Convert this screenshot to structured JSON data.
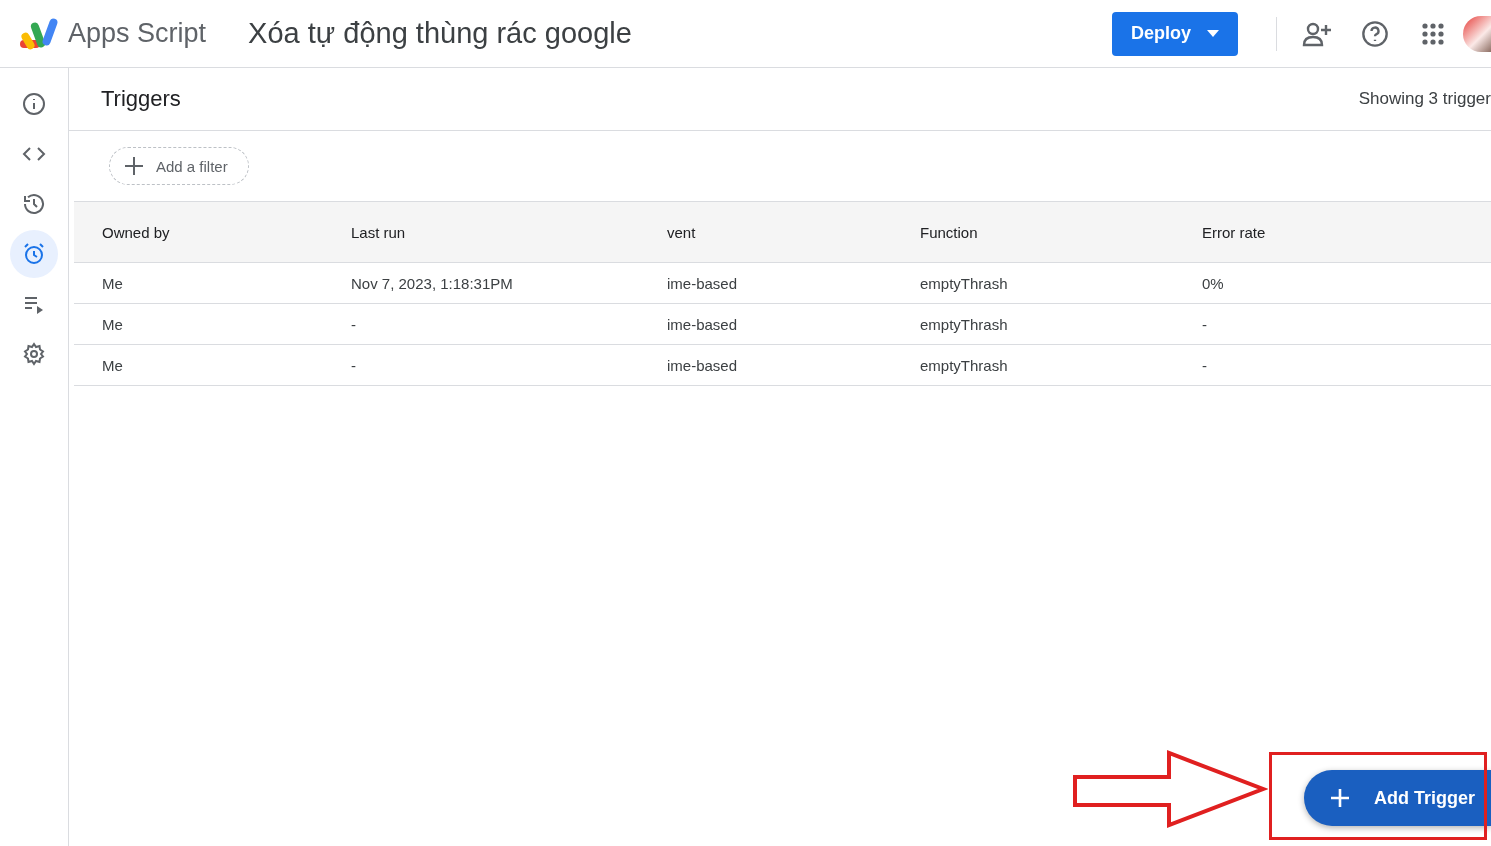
{
  "header": {
    "product": "Apps Script",
    "project_title": "Xóa tự động thùng rác google",
    "deploy_button": "Deploy"
  },
  "sidebar": {
    "items": [
      {
        "kind": "info",
        "selected": false
      },
      {
        "kind": "code",
        "selected": false
      },
      {
        "kind": "history",
        "selected": false
      },
      {
        "kind": "alarm",
        "selected": true
      },
      {
        "kind": "executions",
        "selected": false
      },
      {
        "kind": "settings",
        "selected": false
      }
    ]
  },
  "page": {
    "title": "Triggers",
    "count": "Showing 3 trigger",
    "filter_button": "Add a filter"
  },
  "table": {
    "columns": [
      "Owned by",
      "Last run",
      "vent",
      "Function",
      "Error rate"
    ],
    "rows": [
      [
        "Me",
        "Nov 7, 2023, 1:18:31PM",
        "ime-based",
        "emptyThrash",
        "0%"
      ],
      [
        "Me",
        "-",
        "ime-based",
        "emptyThrash",
        "-"
      ],
      [
        "Me",
        "-",
        "ime-based",
        "emptyThrash",
        "-"
      ]
    ]
  },
  "fab": {
    "label": "Add Trigger"
  }
}
